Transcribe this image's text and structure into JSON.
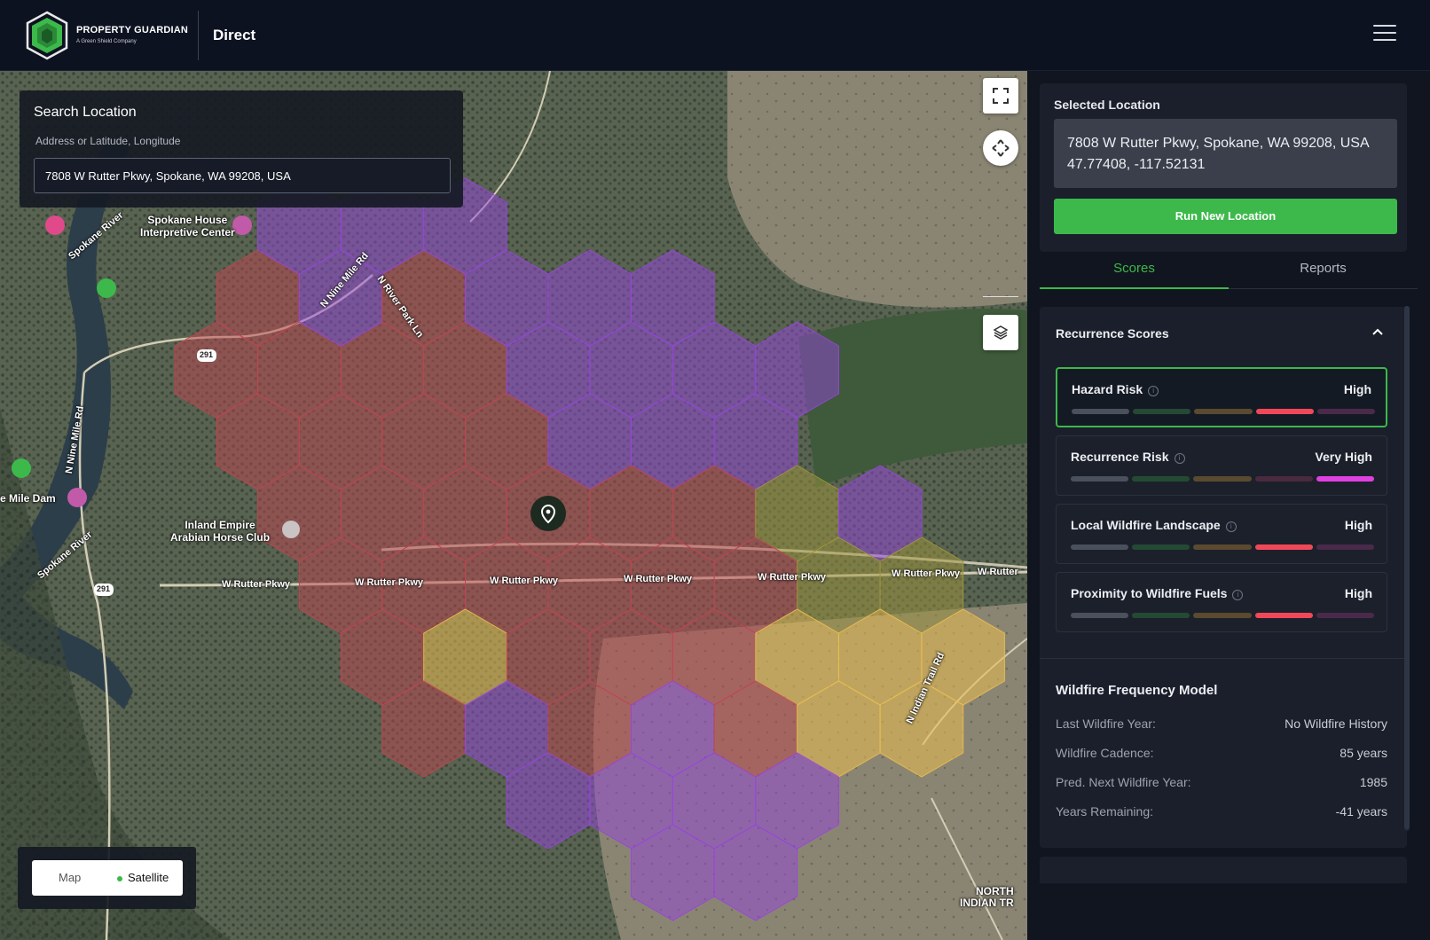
{
  "header": {
    "brand_title": "PROPERTY GUARDIAN",
    "brand_subtitle": "A Green Shield Company",
    "app_name": "Direct"
  },
  "search": {
    "title": "Search Location",
    "hint": "Address or Latitude, Longitude",
    "value": "7808 W Rutter Pkwy, Spokane, WA 99208, USA"
  },
  "map": {
    "places": [
      "Spokane House Interpretive Center",
      "Inland Empire Arabian Horse Club",
      "e Mile Dam"
    ],
    "place_lines": [
      "Spokane House",
      "Interpretive Center",
      "Inland Empire",
      "Arabian Horse Club"
    ],
    "roads": [
      "W Rutter Pkwy",
      "N Nine Mile Rd",
      "N River Park Ln",
      "N Indian Trail Rd",
      "Spokane River",
      "N Nine Mile Rd",
      "W Rutter"
    ],
    "route_badges": [
      "291",
      "291"
    ],
    "corner_label_1": "NORTH",
    "corner_label_2": "INDIAN TR",
    "toggle": {
      "map": "Map",
      "satellite": "Satellite",
      "selected": "Satellite"
    }
  },
  "selected_location": {
    "title": "Selected Location",
    "address": "7808 W Rutter Pkwy, Spokane, WA 99208, USA",
    "coords": "47.77408, -117.52131",
    "run_button": "Run New Location"
  },
  "tabs": [
    {
      "label": "Scores",
      "active": true
    },
    {
      "label": "Reports",
      "active": false
    }
  ],
  "recurrence": {
    "title": "Recurrence Scores",
    "items": [
      {
        "name": "Hazard Risk",
        "level": "High",
        "level_index": 4
      },
      {
        "name": "Recurrence Risk",
        "level": "Very High",
        "level_index": 5
      },
      {
        "name": "Local Wildfire Landscape",
        "level": "High",
        "level_index": 4
      },
      {
        "name": "Proximity to Wildfire Fuels",
        "level": "High",
        "level_index": 4
      }
    ]
  },
  "level_colors": {
    "inactive": [
      "#4a505c",
      "#244a33",
      "#5a4a30",
      "#4a2a3e",
      "#4a2a4a"
    ],
    "active": [
      "#8a909c",
      "#3c9a52",
      "#b08a40",
      "#f04858",
      "#e040e0"
    ]
  },
  "frequency": {
    "title": "Wildfire Frequency Model",
    "rows": [
      {
        "label": "Last Wildfire Year:",
        "value": "No Wildfire History"
      },
      {
        "label": "Wildfire Cadence:",
        "value": "85 years"
      },
      {
        "label": "Pred. Next Wildfire Year:",
        "value": "1985"
      },
      {
        "label": "Years Remaining:",
        "value": "-41 years"
      }
    ]
  }
}
